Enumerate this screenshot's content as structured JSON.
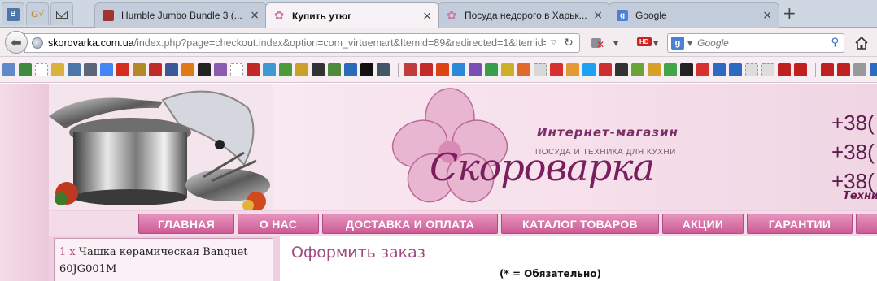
{
  "browser": {
    "pinned_tabs": [
      {
        "name": "vk",
        "label": "В"
      },
      {
        "name": "gv",
        "label": "G√"
      },
      {
        "name": "mail",
        "label": ""
      }
    ],
    "tabs": [
      {
        "title": "Humble Jumbo Bundle 3 (...",
        "icon": "humble-icon",
        "active": false
      },
      {
        "title": "Купить утюг",
        "icon": "flower-icon",
        "active": true
      },
      {
        "title": "Посуда недорого в Харьк...",
        "icon": "flower-icon",
        "active": false
      },
      {
        "title": "Google",
        "icon": "google-icon",
        "active": false
      }
    ],
    "close_glyph": "×",
    "new_tab_glyph": "+",
    "url_host": "skorovarka.com.ua",
    "url_rest": "/index.php?page=checkout.index&option=com_virtuemart&Itemid=89&redirected=1&Itemid=8",
    "search_placeholder": "Google",
    "hd_badge": "HD"
  },
  "bookmarks": {
    "colors": [
      "#5f89c8",
      "#3e8a3e",
      "#ffffff",
      "#d8b23a",
      "#4a76a8",
      "#5d6677",
      "#4285f4",
      "#d62b1f",
      "#b5892b",
      "#c02a2a",
      "#3b5998",
      "#e07a16",
      "#222222",
      "#8a5cb0",
      "#ffffff",
      "#c22828",
      "#3d9ad1",
      "#4c9a3a",
      "#c8a02a",
      "#333333",
      "#4f8a3c",
      "#2a6ab8",
      "#111111",
      "#445566",
      "#c03b3b",
      "#c52a2a",
      "#dd4411",
      "#2a8ad8",
      "#7a4fb5",
      "#38a04a",
      "#c9b12a",
      "#e06a2a",
      "#d8d8d8",
      "#d63030",
      "#e29a36",
      "#1da1f2",
      "#cc2f2f",
      "#333333",
      "#6aa336",
      "#d6a02a",
      "#45a34a",
      "#222222",
      "#d63030",
      "#2d6ac2",
      "#2d6ac2",
      "#dddddd",
      "#dddddd",
      "#c02020",
      "#c02020",
      "#c02020",
      "#c02020",
      "#999999",
      "#2d6ac2",
      "#333333",
      "#d63030",
      "#888888",
      "#dddddd"
    ]
  },
  "site": {
    "shop_subtitle": "Интернет-магазин",
    "shop_tagline": "ПОСУДА И ТЕХНИКА ДЛЯ КУХНИ",
    "brand": "Скороварка",
    "phones": [
      "+38(",
      "+38(",
      "+38("
    ],
    "phone_tag": "Техни",
    "menu": [
      "ГЛАВНАЯ",
      "О НАС",
      "ДОСТАВКА И ОПЛАТА",
      "КАТАЛОГ ТОВАРОВ",
      "АКЦИИ",
      "ГАРАНТИИ"
    ],
    "cart_qty": "1 x",
    "cart_item": "Чашка керамическая Banquet",
    "cart_sku": "60JG001M",
    "order_title": "Оформить заказ",
    "required_note": "(* = Обязательно)"
  },
  "colors": {
    "menu_pink": "#d86aa3",
    "brand_purple": "#7a1f5e",
    "page_bg": "#eecfe0"
  }
}
